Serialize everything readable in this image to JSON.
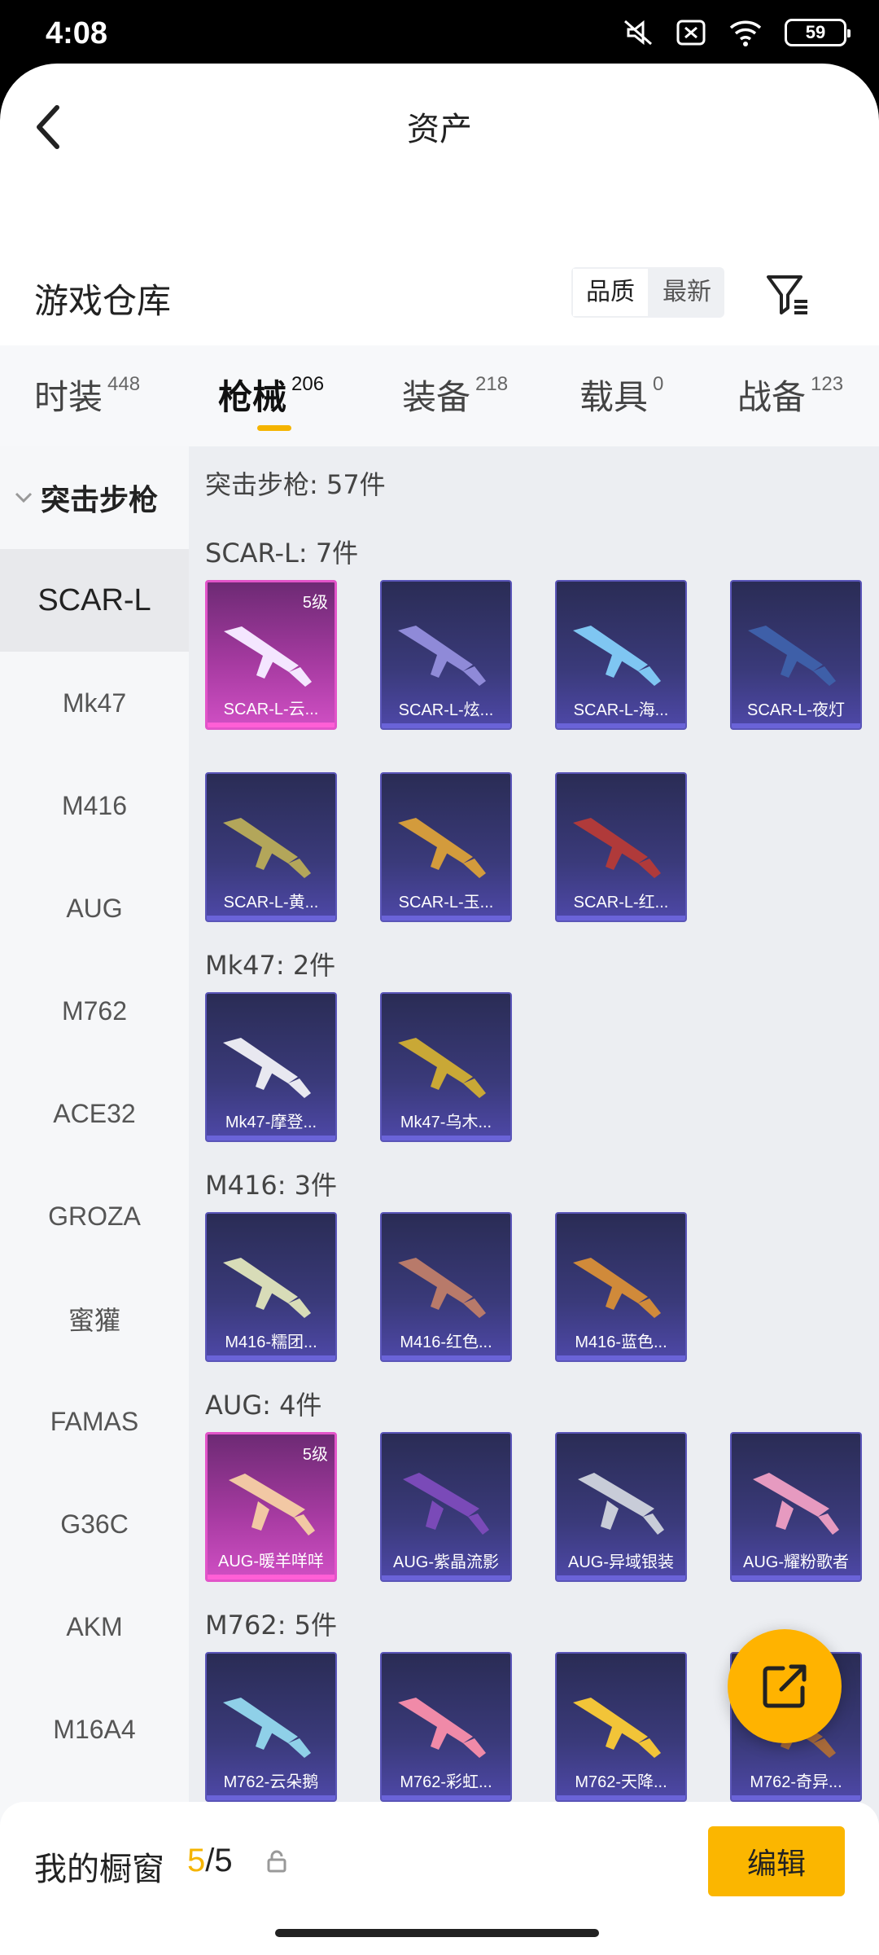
{
  "status": {
    "time": "4:08",
    "battery": "59"
  },
  "header": {
    "title": "资产"
  },
  "warehouse": {
    "title": "游戏仓库",
    "sort_options": [
      "品质",
      "最新"
    ]
  },
  "tabs": [
    {
      "label": "时装",
      "count": "448"
    },
    {
      "label": "枪械",
      "count": "206"
    },
    {
      "label": "装备",
      "count": "218"
    },
    {
      "label": "载具",
      "count": "0"
    },
    {
      "label": "战备",
      "count": "123"
    }
  ],
  "sidebar": {
    "category": "突击步枪",
    "items": [
      "SCAR-L",
      "Mk47",
      "M416",
      "AUG",
      "M762",
      "ACE32",
      "GROZA",
      "蜜獾",
      "FAMAS",
      "G36C",
      "AKM",
      "M16A4"
    ]
  },
  "content": {
    "total": "突击步枪: 57件",
    "groups": [
      {
        "title": "SCAR-L: 7件",
        "items": [
          {
            "label": "SCAR-L-云...",
            "level": "5级"
          },
          {
            "label": "SCAR-L-炫..."
          },
          {
            "label": "SCAR-L-海..."
          },
          {
            "label": "SCAR-L-夜灯"
          },
          {
            "label": "SCAR-L-黄..."
          },
          {
            "label": "SCAR-L-玉..."
          },
          {
            "label": "SCAR-L-红..."
          }
        ]
      },
      {
        "title": "Mk47: 2件",
        "items": [
          {
            "label": "Mk47-摩登..."
          },
          {
            "label": "Mk47-乌木..."
          }
        ]
      },
      {
        "title": "M416: 3件",
        "items": [
          {
            "label": "M416-糯团..."
          },
          {
            "label": "M416-红色..."
          },
          {
            "label": "M416-蓝色..."
          }
        ]
      },
      {
        "title": "AUG: 4件",
        "items": [
          {
            "label": "AUG-暖羊咩咩",
            "level": "5级"
          },
          {
            "label": "AUG-紫晶流影"
          },
          {
            "label": "AUG-异域银装"
          },
          {
            "label": "AUG-耀粉歌者"
          }
        ]
      },
      {
        "title": "M762: 5件",
        "items": [
          {
            "label": "M762-云朵鹅"
          },
          {
            "label": "M762-彩虹..."
          },
          {
            "label": "M762-天降..."
          },
          {
            "label": "M762-奇异..."
          }
        ]
      }
    ]
  },
  "showcase": {
    "label": "我的橱窗",
    "current": "5",
    "total": "/5",
    "edit_label": "编辑"
  },
  "colors": {
    "accent": "#f5b400",
    "card_purple": "#3a3a7a",
    "card_pink": "#d04fc4"
  }
}
